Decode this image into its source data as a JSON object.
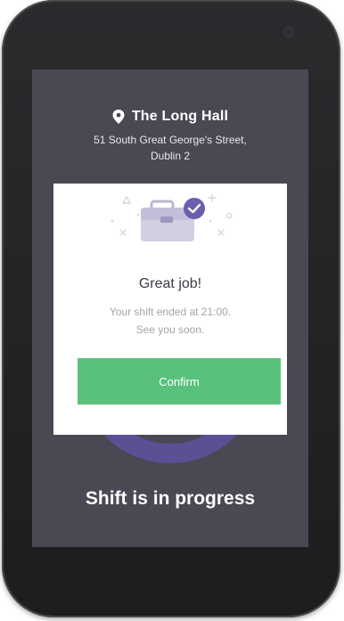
{
  "location": {
    "pin_icon": "map-pin-icon",
    "venue_name": "The Long Hall",
    "address_line1": "51 South Great George's Street,",
    "address_line2": "Dublin 2"
  },
  "modal": {
    "illustration_icon": "briefcase-check-icon",
    "title": "Great job!",
    "message_line1": "Your shift ended at 21:00.",
    "message_line2": "See you soon.",
    "confirm_label": "Confirm"
  },
  "status": {
    "text": "Shift is in progress"
  },
  "colors": {
    "screen_background": "#4a4853",
    "accent_purple": "#6a5fae",
    "confirm_green": "#59c17b",
    "card_background": "#ffffff"
  }
}
